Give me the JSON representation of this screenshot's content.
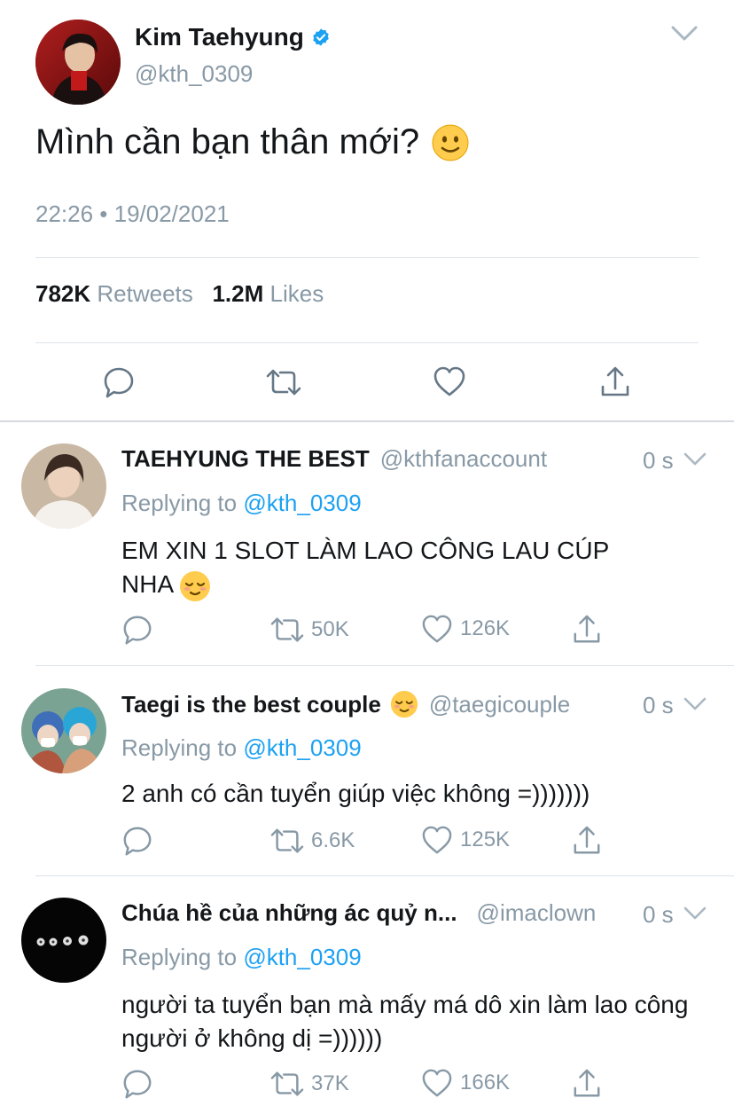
{
  "tweet": {
    "author_name": "Kim Taehyung",
    "author_handle": "@kth_0309",
    "text": "Mình cần bạn thân mới?",
    "timestamp": "22:26 • 19/02/2021",
    "retweets_count": "782K",
    "retweets_label": "Retweets",
    "likes_count": "1.2M",
    "likes_label": "Likes"
  },
  "replies": [
    {
      "name": "TAEHYUNG THE BEST",
      "handle": "@kthfanaccount",
      "time": "0 s",
      "replying_label": "Replying to",
      "replying_handle": "@kth_0309",
      "text": "EM XIN 1 SLOT LÀM LAO CÔNG LAU CÚP NHA",
      "retweets": "50K",
      "likes": "126K"
    },
    {
      "name": "Taegi is the best couple",
      "handle": "@taegicouple",
      "time": "0 s",
      "replying_label": "Replying to",
      "replying_handle": "@kth_0309",
      "text": "2 anh có cần tuyển giúp việc không =)))))))",
      "retweets": "6.6K",
      "likes": "125K"
    },
    {
      "name": "Chúa hề của những ác quỷ n...",
      "handle": "@imaclown",
      "time": "0 s",
      "replying_label": "Replying to",
      "replying_handle": "@kth_0309",
      "text": "người ta tuyển bạn mà mấy má dô xin làm lao công người ở không dị =))))))",
      "retweets": "37K",
      "likes": "166K"
    }
  ],
  "colors": {
    "accent": "#1da1f2",
    "muted": "#8899a6",
    "text": "#14171a"
  }
}
